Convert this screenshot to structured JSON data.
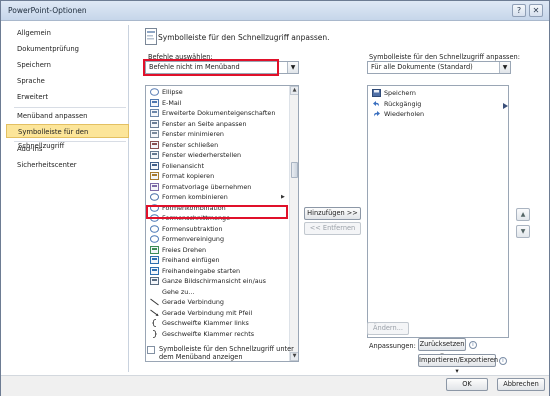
{
  "window": {
    "title": "PowerPoint-Optionen",
    "help_icon": "?",
    "close_icon": "✕"
  },
  "sidebar": {
    "items": [
      {
        "label": "Allgemein"
      },
      {
        "label": "Dokumentprüfung"
      },
      {
        "label": "Speichern"
      },
      {
        "label": "Sprache"
      },
      {
        "label": "Erweitert"
      },
      {
        "label": "Menüband anpassen"
      },
      {
        "label": "Symbolleiste für den Schnellzugriff"
      },
      {
        "label": "Add-Ins"
      },
      {
        "label": "Sicherheitscenter"
      }
    ],
    "selected_index": 6
  },
  "main": {
    "heading": "Symbolleiste für den Schnellzugriff anpassen.",
    "choose_label": "Befehle auswählen:",
    "choose_value": "Befehle nicht im Menüband",
    "qat_label": "Symbolleiste für den Schnellzugriff anpassen:",
    "qat_value": "Für alle Dokumente (Standard)",
    "commands": [
      {
        "label": "Ellipse",
        "icon": "ellipse-icon"
      },
      {
        "label": "E-Mail",
        "icon": "email-icon"
      },
      {
        "label": "Erweiterte Dokumenteigenschaften",
        "icon": "doc-properties-icon"
      },
      {
        "label": "Fenster an Seite anpassen",
        "icon": "fit-window-icon"
      },
      {
        "label": "Fenster minimieren",
        "icon": "minimize-icon"
      },
      {
        "label": "Fenster schließen",
        "icon": "close-window-icon"
      },
      {
        "label": "Fenster wiederherstellen",
        "icon": "restore-window-icon"
      },
      {
        "label": "Folienansicht",
        "icon": "slide-view-icon"
      },
      {
        "label": "Format kopieren",
        "icon": "format-painter-icon"
      },
      {
        "label": "Formatvorlage übernehmen",
        "icon": "style-icon"
      },
      {
        "label": "Formen kombinieren",
        "icon": "combine-shapes-icon",
        "has_submenu": true
      },
      {
        "label": "Formenkombination",
        "icon": "shape-union-icon"
      },
      {
        "label": "Formenschnittmenge",
        "icon": "shape-intersect-icon"
      },
      {
        "label": "Formensubtraktion",
        "icon": "shape-subtract-icon"
      },
      {
        "label": "Formenvereinigung",
        "icon": "shape-combine-icon"
      },
      {
        "label": "Freies Drehen",
        "icon": "free-rotate-icon"
      },
      {
        "label": "Freihand einfügen",
        "icon": "ink-insert-icon"
      },
      {
        "label": "Freihandeingabe starten",
        "icon": "ink-start-icon"
      },
      {
        "label": "Ganze Bildschirmansicht ein/aus",
        "icon": "fullscreen-icon"
      },
      {
        "label": "Gehe zu...",
        "icon": "blank-icon"
      },
      {
        "label": "Gerade Verbindung",
        "icon": "line-connector-icon"
      },
      {
        "label": "Gerade Verbindung mit Pfeil",
        "icon": "arrow-connector-icon"
      },
      {
        "label": "Geschweifte Klammer links",
        "icon": "brace-left-icon"
      },
      {
        "label": "Geschweifte Klammer rechts",
        "icon": "brace-right-icon"
      }
    ],
    "qat_items": [
      {
        "label": "Speichern",
        "icon": "save-icon"
      },
      {
        "label": "Rückgängig",
        "icon": "undo-icon"
      },
      {
        "label": "Wiederholen",
        "icon": "redo-icon"
      }
    ],
    "add_button": "Hinzufügen >>",
    "remove_button": "<< Entfernen",
    "modify_button": "Ändern...",
    "show_below_label": "Symbolleiste für den Schnellzugriff unter dem Menüband anzeigen",
    "customizations_label": "Anpassungen:",
    "reset_button": "Zurücksetzen",
    "import_export_button": "Importieren/Exportieren"
  },
  "footer": {
    "ok": "OK",
    "cancel": "Abbrechen"
  }
}
